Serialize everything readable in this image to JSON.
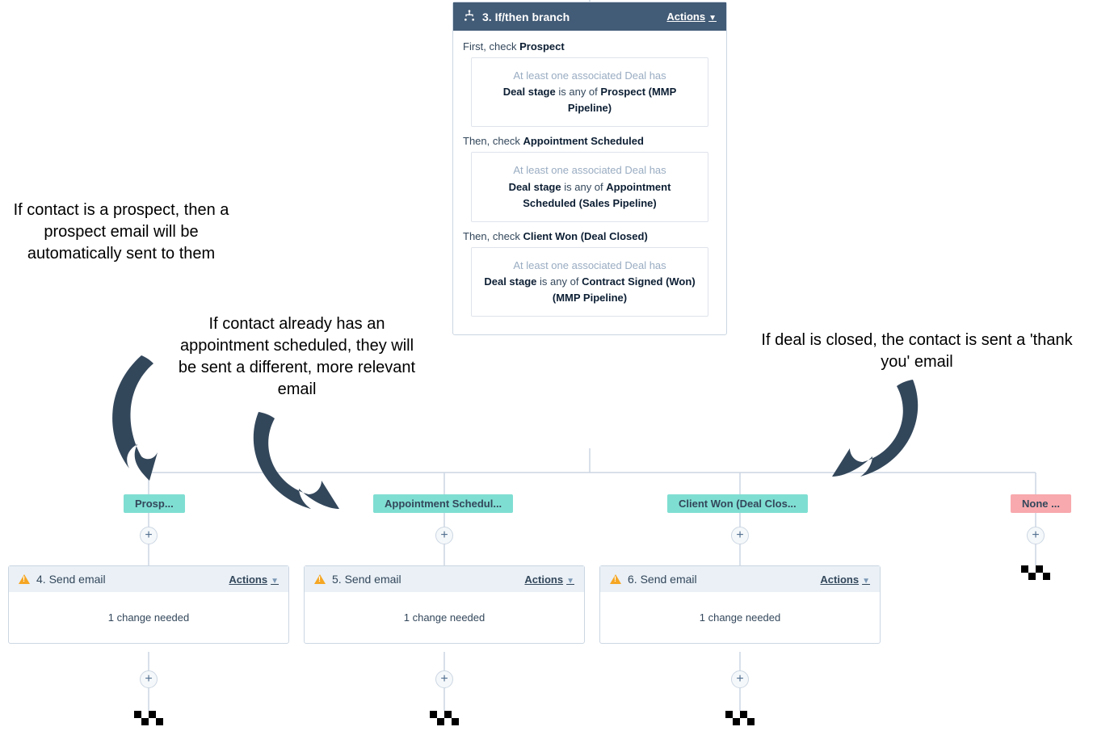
{
  "branch": {
    "step_number": "3",
    "title": "If/then branch",
    "actions_label": "Actions",
    "checks": [
      {
        "prefix": "First, check",
        "name": "Prospect",
        "condition_faint": "At least one associated Deal has",
        "condition_field": "Deal stage",
        "condition_middle": "is any of",
        "condition_value": "Prospect (MMP Pipeline)"
      },
      {
        "prefix": "Then, check",
        "name": "Appointment Scheduled",
        "condition_faint": "At least one associated Deal has",
        "condition_field": "Deal stage",
        "condition_middle": "is any of",
        "condition_value": "Appointment Scheduled (Sales Pipeline)"
      },
      {
        "prefix": "Then, check",
        "name": "Client Won (Deal Closed)",
        "condition_faint": "At least one associated Deal has",
        "condition_field": "Deal stage",
        "condition_middle": "is any of",
        "condition_value": "Contract Signed (Won) (MMP Pipeline)"
      }
    ]
  },
  "branch_pills": [
    {
      "label": "Prosp...",
      "type": "green"
    },
    {
      "label": "Appointment Schedul...",
      "type": "green"
    },
    {
      "label": "Client Won (Deal Clos...",
      "type": "green"
    },
    {
      "label": "None ...",
      "type": "red"
    }
  ],
  "action_cards": [
    {
      "step": "4",
      "title": "Send email",
      "actions_label": "Actions",
      "body": "1 change needed"
    },
    {
      "step": "5",
      "title": "Send email",
      "actions_label": "Actions",
      "body": "1 change needed"
    },
    {
      "step": "6",
      "title": "Send email",
      "actions_label": "Actions",
      "body": "1 change needed"
    }
  ],
  "annotations": [
    {
      "text": "If contact is a prospect, then a prospect email will be automatically sent to them"
    },
    {
      "text": "If contact already has an appointment scheduled, they will be sent a different, more relevant email"
    },
    {
      "text": "If deal is closed, the contact is sent a 'thank you' email"
    }
  ],
  "plus_label": "+"
}
